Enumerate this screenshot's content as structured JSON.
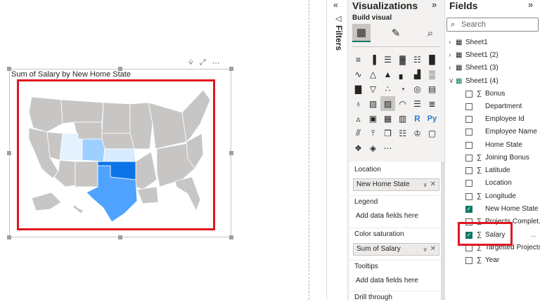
{
  "visual": {
    "title": "Sum of Salary by New Home State",
    "toolbar": {
      "filter_icon": "filter-icon",
      "focus_icon": "focus-mode-icon",
      "more_icon": "more-options-icon"
    }
  },
  "map": {
    "highlighted_states": [
      {
        "state": "Texas",
        "color": "#4da3ff"
      },
      {
        "state": "Oklahoma",
        "color": "#0a74e8"
      },
      {
        "state": "Colorado",
        "color": "#9ecfff"
      },
      {
        "state": "Kansas",
        "color": "#d9ecff"
      },
      {
        "state": "Utah",
        "color": "#e4f1ff"
      }
    ],
    "base_color": "#c8c6c4"
  },
  "filters": {
    "label": "Filters",
    "chevron": "«"
  },
  "visualizations": {
    "title": "Visualizations",
    "collapse": "»",
    "build_label": "Build visual",
    "wells": [
      {
        "label": "Location",
        "value": "New Home State",
        "filled": true
      },
      {
        "label": "Legend",
        "value": "Add data fields here",
        "filled": false
      },
      {
        "label": "Color saturation",
        "value": "Sum of Salary",
        "filled": true
      },
      {
        "label": "Tooltips",
        "value": "Add data fields here",
        "filled": false
      },
      {
        "label": "Drill through",
        "value": "",
        "filled": false
      }
    ]
  },
  "fields": {
    "title": "Fields",
    "collapse": "»",
    "search_placeholder": "Search",
    "tables": [
      {
        "name": "Sheet1",
        "expanded": false
      },
      {
        "name": "Sheet1 (2)",
        "expanded": false
      },
      {
        "name": "Sheet1 (3)",
        "expanded": false
      },
      {
        "name": "Sheet1 (4)",
        "expanded": true
      }
    ],
    "items": [
      {
        "name": "Bonus",
        "sigma": true,
        "checked": false
      },
      {
        "name": "Department",
        "sigma": false,
        "checked": false
      },
      {
        "name": "Employee Id",
        "sigma": false,
        "checked": false
      },
      {
        "name": "Employee Name",
        "sigma": false,
        "checked": false
      },
      {
        "name": "Home State",
        "sigma": false,
        "checked": false
      },
      {
        "name": "Joining Bonus",
        "sigma": true,
        "checked": false
      },
      {
        "name": "Latitude",
        "sigma": true,
        "checked": false
      },
      {
        "name": "Location",
        "sigma": false,
        "checked": false
      },
      {
        "name": "Longitude",
        "sigma": true,
        "checked": false
      },
      {
        "name": "New Home State",
        "sigma": false,
        "checked": true
      },
      {
        "name": "Projects Complet...",
        "sigma": true,
        "checked": false
      },
      {
        "name": "Salary",
        "sigma": true,
        "checked": true
      },
      {
        "name": "Targetted Projects",
        "sigma": true,
        "checked": false
      },
      {
        "name": "Year",
        "sigma": true,
        "checked": false
      }
    ],
    "more_label": "..."
  }
}
